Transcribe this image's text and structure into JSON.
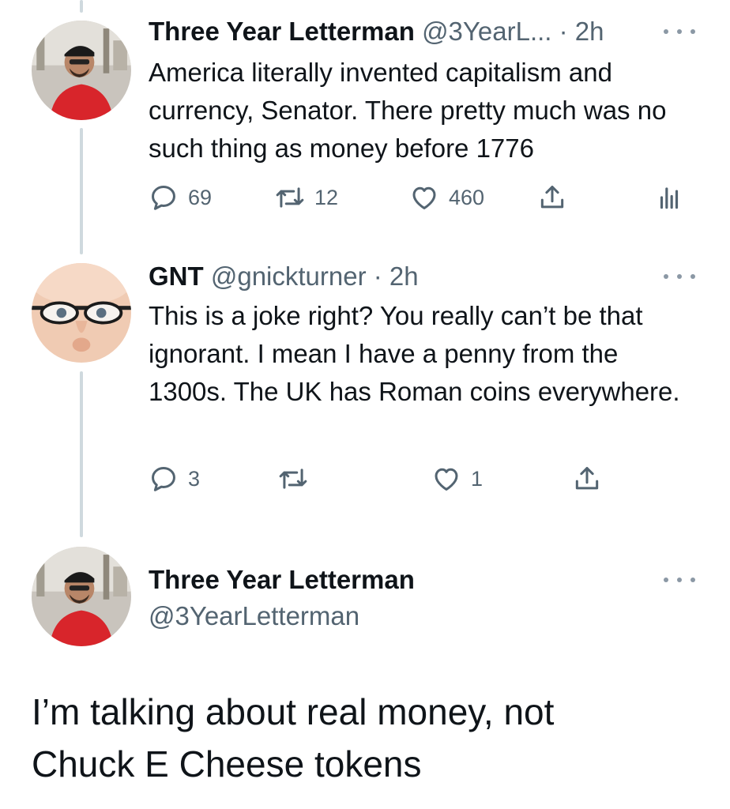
{
  "tweets": [
    {
      "display_name": "Three Year Letterman",
      "handle": "@3YearL...",
      "time": "· 2h",
      "text": "America literally invented capitalism and currency, Senator. There pretty much was no such thing as money before 1776",
      "replies": "69",
      "retweets": "12",
      "likes": "460"
    },
    {
      "display_name": "GNT",
      "handle": "@gnickturner",
      "time": "· 2h",
      "text": "This is a joke right? You really can’t be that ignorant. I mean I have a penny from the 1300s. The UK has Roman coins everywhere.",
      "replies": "3",
      "retweets": "",
      "likes": "1"
    }
  ],
  "main_tweet": {
    "display_name": "Three Year Letterman",
    "handle": "@3YearLetterman",
    "text": "I’m talking about real money, not Chuck E Cheese tokens"
  },
  "icons": {
    "reply": "reply-icon",
    "retweet": "retweet-icon",
    "like": "heart-icon",
    "share": "share-icon",
    "analytics": "analytics-icon",
    "more": "more-icon"
  },
  "colors": {
    "text": "#0f1419",
    "muted": "#536471",
    "thread_line": "#cfd9de"
  }
}
